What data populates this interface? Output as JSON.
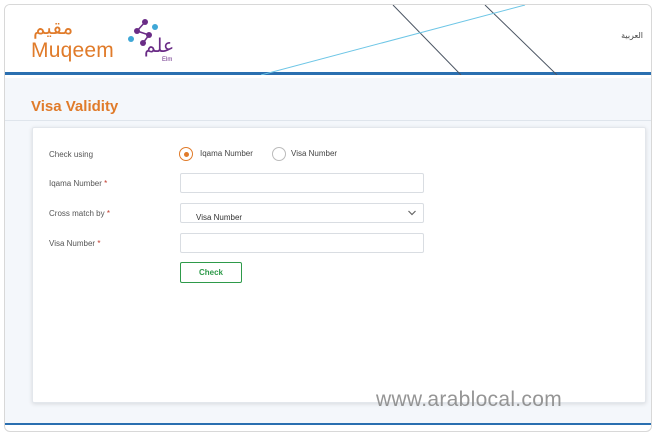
{
  "header": {
    "logo_arabic": "مقيم",
    "logo_english": "Muqeem",
    "partner_logo_arabic": "علم",
    "partner_logo_english": "Elm",
    "language_link": "العربية"
  },
  "page": {
    "title": "Visa Validity"
  },
  "form": {
    "check_using_label": "Check using",
    "radio_options": [
      {
        "label": "Iqama Number",
        "selected": true
      },
      {
        "label": "Visa Number",
        "selected": false
      }
    ],
    "iqama_label": "Iqama Number",
    "iqama_value": "",
    "cross_match_label": "Cross match by",
    "cross_match_value": "Visa Number",
    "visa_label": "Visa Number",
    "visa_value": "",
    "required_marker": "*",
    "check_button": "Check"
  },
  "watermark": "www.arablocal.com",
  "colors": {
    "brand_orange": "#e07b2a",
    "header_blue": "#2a6fb0",
    "elm_purple": "#6a2c86",
    "button_green": "#2e9a4a"
  }
}
